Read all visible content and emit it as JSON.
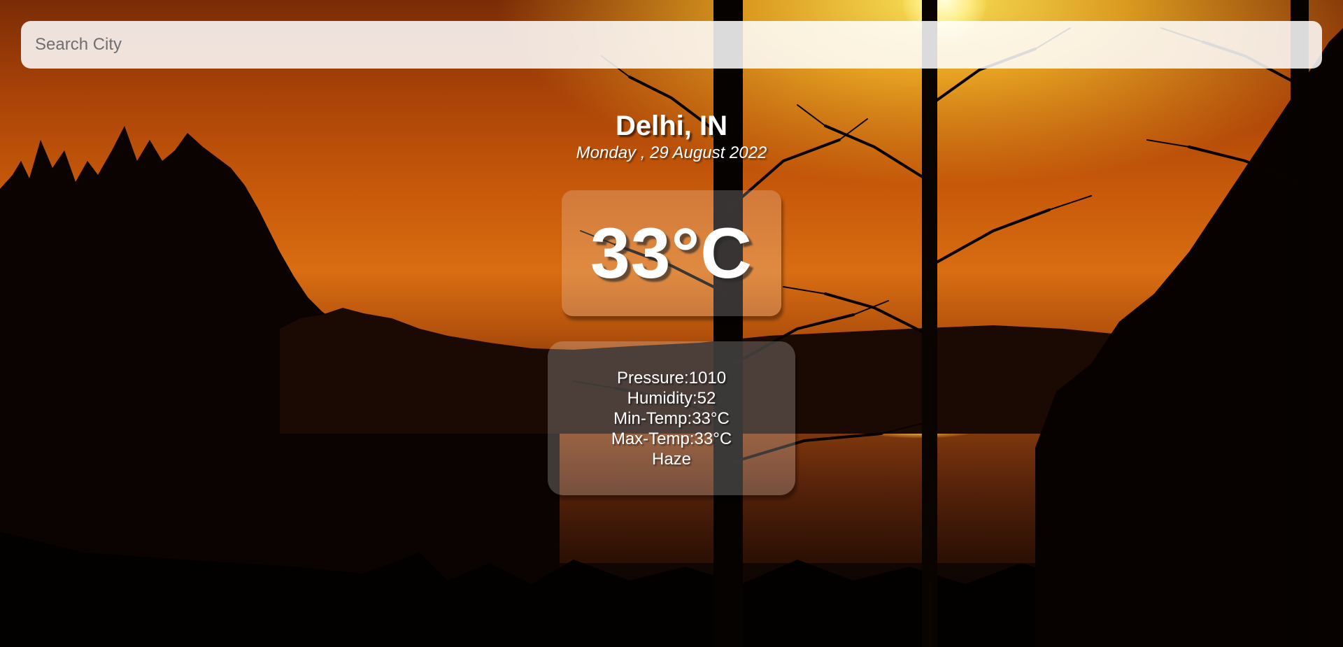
{
  "search": {
    "placeholder": "Search City",
    "value": ""
  },
  "weather": {
    "location": "Delhi, IN",
    "date": "Monday , 29 August 2022",
    "temperature": "33°C",
    "details": {
      "pressure": "Pressure:1010",
      "humidity": "Humidity:52",
      "min_temp": "Min-Temp:33°C",
      "max_temp": "Max-Temp:33°C",
      "condition": "Haze"
    }
  },
  "background": {
    "scene": "sunset-forest-lake",
    "colors": {
      "sky_top": "#7a2c06",
      "sky_mid": "#c85a0a",
      "sun_glow": "#ffe05a",
      "silhouette": "#000000"
    }
  }
}
